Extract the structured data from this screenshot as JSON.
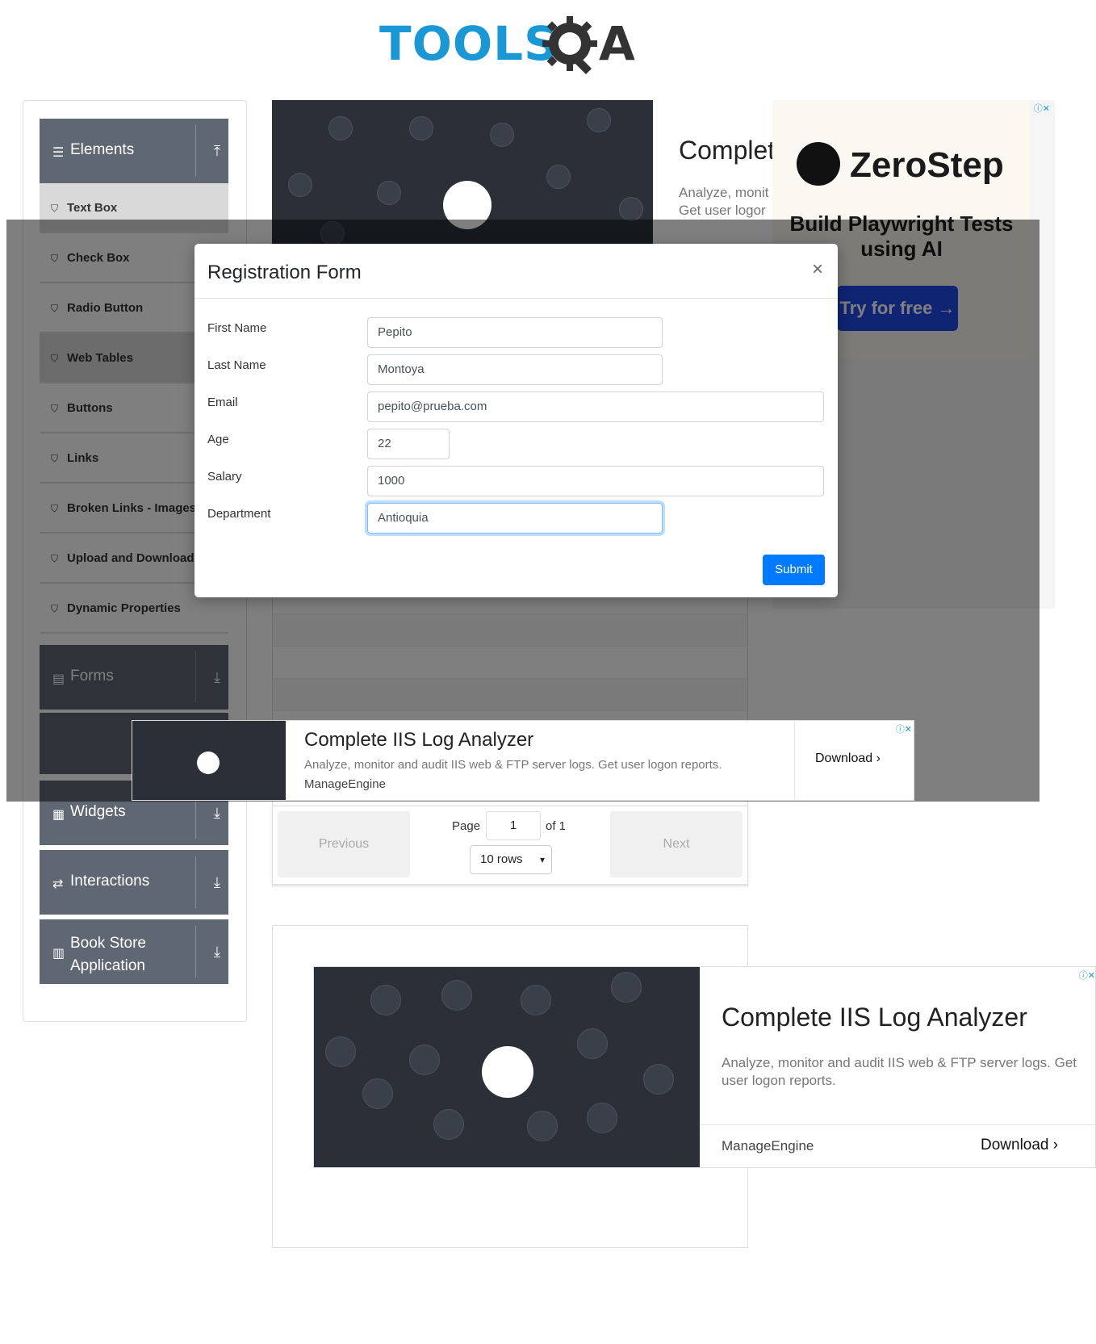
{
  "header": {
    "logo_text_left": "TOOLS",
    "logo_text_right": "A"
  },
  "sidebar": {
    "elements": {
      "label": "Elements"
    },
    "items": [
      {
        "label": "Text Box"
      },
      {
        "label": "Check Box"
      },
      {
        "label": "Radio Button"
      },
      {
        "label": "Web Tables"
      },
      {
        "label": "Buttons"
      },
      {
        "label": "Links"
      },
      {
        "label": "Broken Links - Images"
      },
      {
        "label": "Upload and Download"
      },
      {
        "label": "Dynamic Properties"
      }
    ],
    "forms": {
      "label": "Forms"
    },
    "widgets": {
      "label": "Widgets"
    },
    "interactions": {
      "label": "Interactions"
    },
    "bookstore": {
      "label_line1": "Book Store",
      "label_line2": "Application"
    }
  },
  "top_ad": {
    "headline": "Complet",
    "sub_line1": "Analyze, monit",
    "sub_line2": "Get user logor"
  },
  "zerostep_ad": {
    "brand": "ZeroStep",
    "tagline": "Build Playwright Tests using AI",
    "button": "Try for free →"
  },
  "modal": {
    "title": "Registration Form",
    "close": "×",
    "fields": [
      {
        "label": "First Name",
        "value": "Pepito"
      },
      {
        "label": "Last Name",
        "value": "Montoya"
      },
      {
        "label": "Email",
        "value": "pepito@prueba.com"
      },
      {
        "label": "Age",
        "value": "22"
      },
      {
        "label": "Salary",
        "value": "1000"
      },
      {
        "label": "Department",
        "value": "Antioquia"
      }
    ],
    "submit": "Submit"
  },
  "middle_ad": {
    "headline": "Complete IIS Log Analyzer",
    "sub": "Analyze, monitor and audit IIS web & FTP server logs. Get user logon reports.",
    "brand": "ManageEngine",
    "cta": "Download"
  },
  "pagination": {
    "previous": "Previous",
    "next": "Next",
    "page_label": "Page",
    "page_value": "1",
    "of_label": "of 1",
    "rows_value": "10 rows"
  },
  "bottom_ad": {
    "headline": "Complete IIS Log Analyzer",
    "sub": "Analyze, monitor and audit IIS web & FTP server logs. Get user logon reports.",
    "brand": "ManageEngine",
    "cta": "Download"
  },
  "colors": {
    "brand_blue": "#1a98d5",
    "sidebar_header": "#5f6772",
    "submit_blue": "#007bff",
    "overlay": "rgba(0,0,0,0.5)"
  },
  "icons": [
    "hamburger-icon",
    "upload-arrow-icon",
    "download-arrow-icon",
    "html5-icon",
    "gear-icon",
    "close-icon",
    "chevron-right-icon",
    "adchoices-icon",
    "chevron-down-icon"
  ]
}
